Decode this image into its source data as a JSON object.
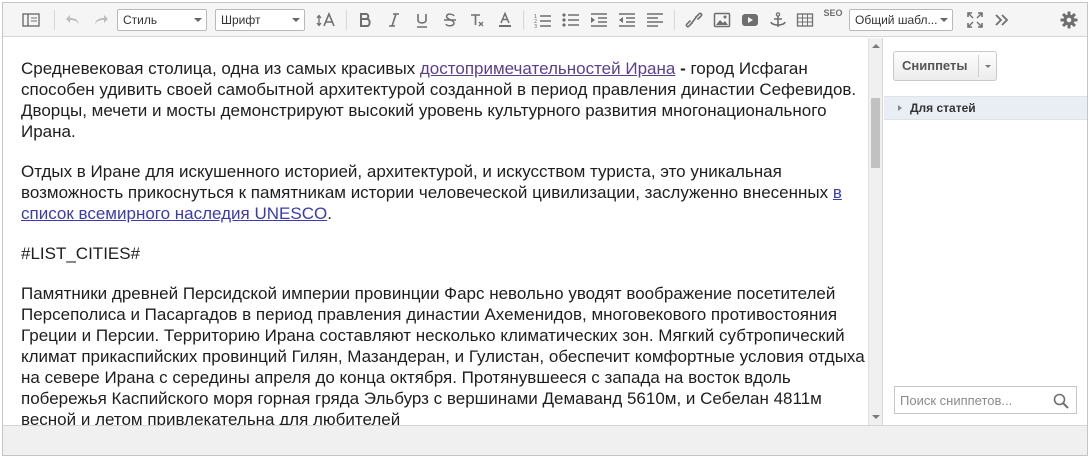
{
  "toolbar": {
    "style_select": "Стиль",
    "font_select": "Шрифт",
    "template_select": "Общий шабл...",
    "seo_label": "SEO"
  },
  "content": {
    "p1_before": "Средневековая столица, одна из самых красивых ",
    "p1_link": "достопримечательностей Ирана",
    "p1_bold": " - ",
    "p1_after": "город Исфаган способен удивить своей самобытной архитектурой созданной в период правления династии Сефевидов. Дворцы, мечети и мосты демонстрируют высокий уровень культурного развития многонационального Ирана.",
    "p2_before": "Отдых в Иране для искушенного историей, архитектурой, и искусством туриста, это уникальная возможность прикоснуться к памятникам истории человеческой цивилизации, заслуженно внесенных ",
    "p2_link": "в список всемирного наследия UNESCO",
    "p2_after": ".",
    "p3": "#LIST_CITIES#",
    "p4": "Памятники древней Персидской империи провинции Фарс невольно уводят воображение посетителей Персеполиса и Пасаргадов в период правления династии Ахеменидов, многовекового противостояния Греции и Персии. Территорию Ирана составляют несколько климатических зон. Мягкий субтропический климат прикаспийских провинций Гилян, Мазандеран, и Гулистан, обеспечит комфортные условия отдыха на севере Ирана с середины апреля до конца октября. Протянувшееся с запада на восток вдоль побережья Каспийского моря горная гряда Эльбурз с вершинами Демаванд 5610м, и Себелан 4811м весной и летом привлекательна для любителей"
  },
  "panel": {
    "snippets_button": "Сниппеты",
    "tree_item": "Для статей",
    "search_placeholder": "Поиск сниппетов..."
  }
}
